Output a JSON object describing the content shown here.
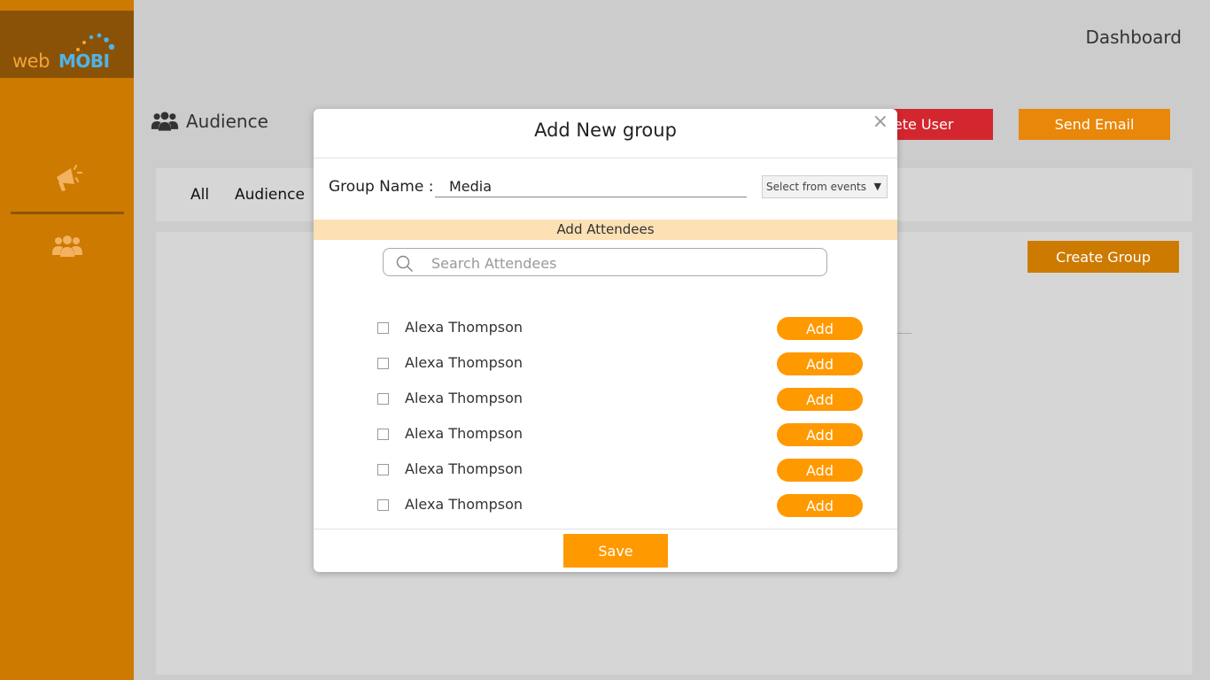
{
  "brand": {
    "logo_part1": "web",
    "logo_part2": "MOBI"
  },
  "header": {
    "dashboard_label": "Dashboard"
  },
  "page": {
    "title": "Audience"
  },
  "header_buttons": {
    "delete_user": "elete User",
    "send_email": "Send Email"
  },
  "tabs": [
    {
      "label": "All"
    },
    {
      "label": "Audience"
    }
  ],
  "content": {
    "create_group_label": "Create Group"
  },
  "modal": {
    "title": "Add New group",
    "close_glyph": "×",
    "group_name_label": "Group Name :",
    "group_name_value": "Media",
    "select_events_value": "Select from events",
    "add_attendees_label": "Add Attendees",
    "search_placeholder": "Search Attendees",
    "attendees": [
      {
        "name": "Alexa Thompson",
        "add_label": "Add"
      },
      {
        "name": "Alexa Thompson",
        "add_label": "Add"
      },
      {
        "name": "Alexa Thompson",
        "add_label": "Add"
      },
      {
        "name": "Alexa Thompson",
        "add_label": "Add"
      },
      {
        "name": "Alexa Thompson",
        "add_label": "Add"
      },
      {
        "name": "Alexa Thompson",
        "add_label": "Add"
      }
    ],
    "save_label": "Save"
  },
  "colors": {
    "sidebar": "#cd7a00",
    "accent": "#ff9900",
    "danger": "#d4262e",
    "attendees_bar": "#fde0b4"
  }
}
